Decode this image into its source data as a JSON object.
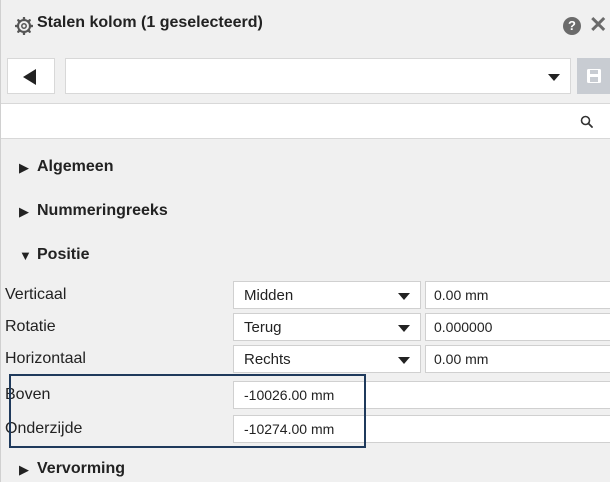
{
  "panel": {
    "title": "Stalen kolom (1 geselecteerd)",
    "help_glyph": "?",
    "close_glyph": "✕"
  },
  "selector": {
    "preset_value": ""
  },
  "search": {
    "value": ""
  },
  "sections": [
    {
      "label": "Algemeen",
      "expanded": false
    },
    {
      "label": "Nummeringreeks",
      "expanded": false
    },
    {
      "label": "Positie",
      "expanded": true
    },
    {
      "label": "Vervorming",
      "expanded": false
    }
  ],
  "positie": {
    "verticaal": {
      "label": "Verticaal",
      "option": "Midden",
      "value": "0.00 mm"
    },
    "rotatie": {
      "label": "Rotatie",
      "option": "Terug",
      "value": "0.000000"
    },
    "horizontaal": {
      "label": "Horizontaal",
      "option": "Rechts",
      "value": "0.00 mm"
    },
    "boven": {
      "label": "Boven",
      "value": "-10026.00 mm"
    },
    "onderzijde": {
      "label": "Onderzijde",
      "value": "-10274.00 mm"
    }
  },
  "colors": {
    "panel_bg": "#f0f0f0",
    "highlight_border": "#1f3a5c",
    "save_button_bg": "#c8ccd2",
    "icon_gray": "#6b6b6b"
  }
}
